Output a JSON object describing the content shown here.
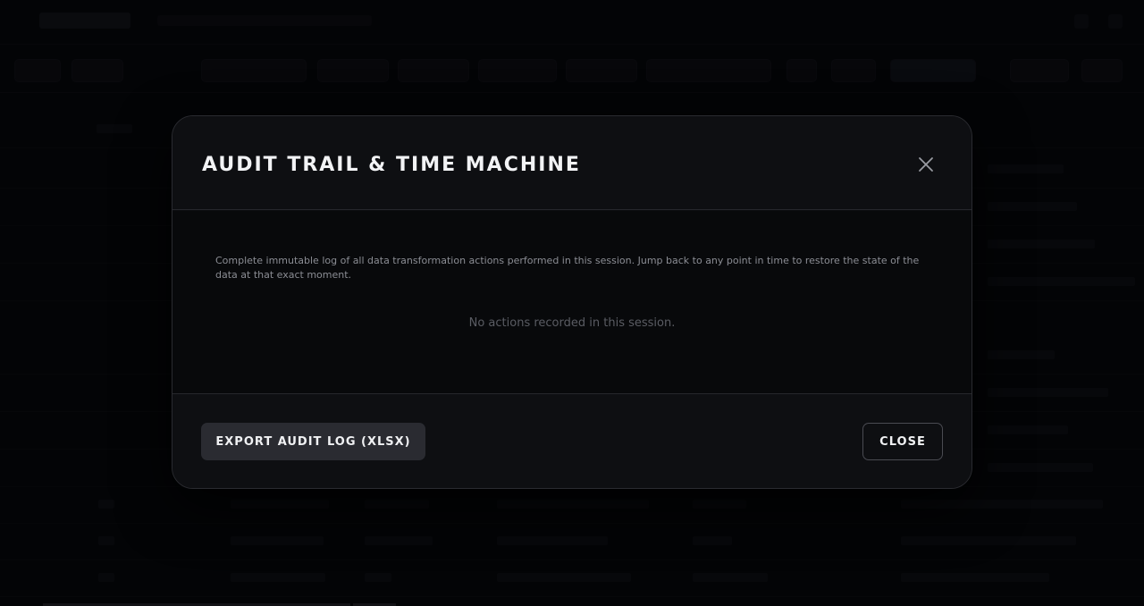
{
  "modal": {
    "title": "AUDIT TRAIL & TIME MACHINE",
    "close_icon": "close-icon",
    "description": "Complete immutable log of all data transformation actions performed in this session. Jump back to any point in time to restore the state of the data at that exact moment.",
    "empty_message": "No actions recorded in this session.",
    "footer": {
      "export_label": "EXPORT AUDIT LOG (XLSX)",
      "close_label": "CLOSE"
    }
  },
  "colors": {
    "overlay": "#000000",
    "modal_bg": "#0c0d10",
    "title_text": "#f2f3f5",
    "export_button_bg": "#2a2b31",
    "close_button_border": "#4a4b52"
  }
}
